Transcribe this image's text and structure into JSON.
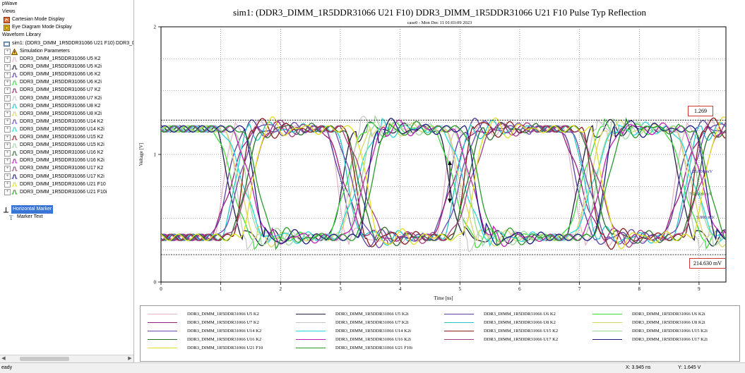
{
  "sidebar": {
    "root_label": "pWave",
    "views_label": "Views",
    "cartesian_label": "Cartesian Mode Display",
    "eye_label": "Eye Diagram Mode Display",
    "waveform_library_label": "Waveform Library",
    "sim_label": "sim1: (DDR3_DIMM_1R5DDR31066 U21 F10) DDR3_D",
    "sim_params_label": "Simulation Parameters",
    "waveforms": [
      {
        "label": "DDR3_DIMM_1R5DDR31066 U5 K2",
        "color": "#e5b6c9"
      },
      {
        "label": "DDR3_DIMM_1R5DDR31066 U5 K2i",
        "color": "#222244"
      },
      {
        "label": "DDR3_DIMM_1R5DDR31066 U6 K2",
        "color": "#5a3fa0"
      },
      {
        "label": "DDR3_DIMM_1R5DDR31066 U6 K2i",
        "color": "#3ddc3d"
      },
      {
        "label": "DDR3_DIMM_1R5DDR31066 U7 K2",
        "color": "#9c1f7a"
      },
      {
        "label": "DDR3_DIMM_1R5DDR31066 U7 K2i",
        "color": "#c9c9c9"
      },
      {
        "label": "DDR3_DIMM_1R5DDR31066 U8 K2",
        "color": "#20c8c8"
      },
      {
        "label": "DDR3_DIMM_1R5DDR31066 U8 K2i",
        "color": "#d9d36a"
      },
      {
        "label": "DDR3_DIMM_1R5DDR31066 U14 K2",
        "color": "#6b4ab0"
      },
      {
        "label": "DDR3_DIMM_1R5DDR31066 U14 K2i",
        "color": "#28d8d8"
      },
      {
        "label": "DDR3_DIMM_1R5DDR31066 U15 K2",
        "color": "#8a1d1d"
      },
      {
        "label": "DDR3_DIMM_1R5DDR31066 U15 K2i",
        "color": "#9fd7a0"
      },
      {
        "label": "DDR3_DIMM_1R5DDR31066 U16 K2",
        "color": "#2e6d2e"
      },
      {
        "label": "DDR3_DIMM_1R5DDR31066 U16 K2i",
        "color": "#c020b0"
      },
      {
        "label": "DDR3_DIMM_1R5DDR31066 U17 K2",
        "color": "#a04080"
      },
      {
        "label": "DDR3_DIMM_1R5DDR31066 U17 K2i",
        "color": "#1a1a80"
      },
      {
        "label": "DDR3_DIMM_1R5DDR31066 U21 F10",
        "color": "#e0e020"
      },
      {
        "label": "DDR3_DIMM_1R5DDR31066 U21 F10i",
        "color": "#2a9a2a"
      }
    ],
    "horizontal_marker_label": "Horizontal Marker",
    "marker_text_label": "Marker Text"
  },
  "plot": {
    "title": "sim1: (DDR3_DIMM_1R5DDR31066 U21 F10) DDR3_DIMM_1R5DDR31066 U21 F10 Pulse Typ Reflection",
    "subtitle": "case0 - Mon Dec 11 01:03:09 2023",
    "xlabel": "Time [ns]",
    "ylabel": "Voltage [V]",
    "markers": {
      "upper": "1.269",
      "lower": "214.630 mV",
      "meas1": "25.000 mV",
      "meas2": "750.000 mV",
      "meas3": "5.000 mV"
    }
  },
  "chart_data": {
    "type": "line",
    "title": "sim1: (DDR3_DIMM_1R5DDR31066 U21 F10) DDR3_DIMM_1R5DDR31066 U21 F10 Pulse Typ Reflection",
    "xlabel": "Time [ns]",
    "ylabel": "Voltage [V]",
    "xlim": [
      0,
      9.45
    ],
    "ylim": [
      0,
      2
    ],
    "x_ticks": [
      0,
      1,
      2,
      3,
      4,
      5,
      6,
      7,
      8,
      9
    ],
    "y_ticks": [
      0,
      1,
      2
    ],
    "high_level": 1.269,
    "low_level": 0.2146,
    "horizontal_markers": [
      1.269,
      0.2146
    ],
    "grid": true,
    "legend_position": "bottom",
    "series": [
      {
        "name": "DDR3_DIMM_1R5DDR31066 U5 K2",
        "color": "#e5b6c9"
      },
      {
        "name": "DDR3_DIMM_1R5DDR31066 U5 K2i",
        "color": "#222244"
      },
      {
        "name": "DDR3_DIMM_1R5DDR31066 U6 K2",
        "color": "#5a3fa0"
      },
      {
        "name": "DDR3_DIMM_1R5DDR31066 U6 K2i",
        "color": "#3ddc3d"
      },
      {
        "name": "DDR3_DIMM_1R5DDR31066 U7 K2",
        "color": "#9c1f7a"
      },
      {
        "name": "DDR3_DIMM_1R5DDR31066 U7 K2i",
        "color": "#c9c9c9"
      },
      {
        "name": "DDR3_DIMM_1R5DDR31066 U8 K2",
        "color": "#20c8c8"
      },
      {
        "name": "DDR3_DIMM_1R5DDR31066 U8 K2i",
        "color": "#d9d36a"
      },
      {
        "name": "DDR3_DIMM_1R5DDR31066 U14 K2",
        "color": "#6b4ab0"
      },
      {
        "name": "DDR3_DIMM_1R5DDR31066 U14 K2i",
        "color": "#28d8d8"
      },
      {
        "name": "DDR3_DIMM_1R5DDR31066 U15 K2",
        "color": "#8a1d1d"
      },
      {
        "name": "DDR3_DIMM_1R5DDR31066 U15 K2i",
        "color": "#9fd7a0"
      },
      {
        "name": "DDR3_DIMM_1R5DDR31066 U16 K2",
        "color": "#2e6d2e"
      },
      {
        "name": "DDR3_DIMM_1R5DDR31066 U16 K2i",
        "color": "#c020b0"
      },
      {
        "name": "DDR3_DIMM_1R5DDR31066 U17 K2",
        "color": "#a04080"
      },
      {
        "name": "DDR3_DIMM_1R5DDR31066 U17 K2i",
        "color": "#1a1a80"
      },
      {
        "name": "DDR3_DIMM_1R5DDR31066 U21 F10",
        "color": "#e0e020"
      },
      {
        "name": "DDR3_DIMM_1R5DDR31066 U21 F10i",
        "color": "#2a9a2a"
      }
    ]
  },
  "status": {
    "ready": "eady",
    "x_readout": "X: 3.945 ns",
    "y_readout": "Y: 1.645 V"
  }
}
